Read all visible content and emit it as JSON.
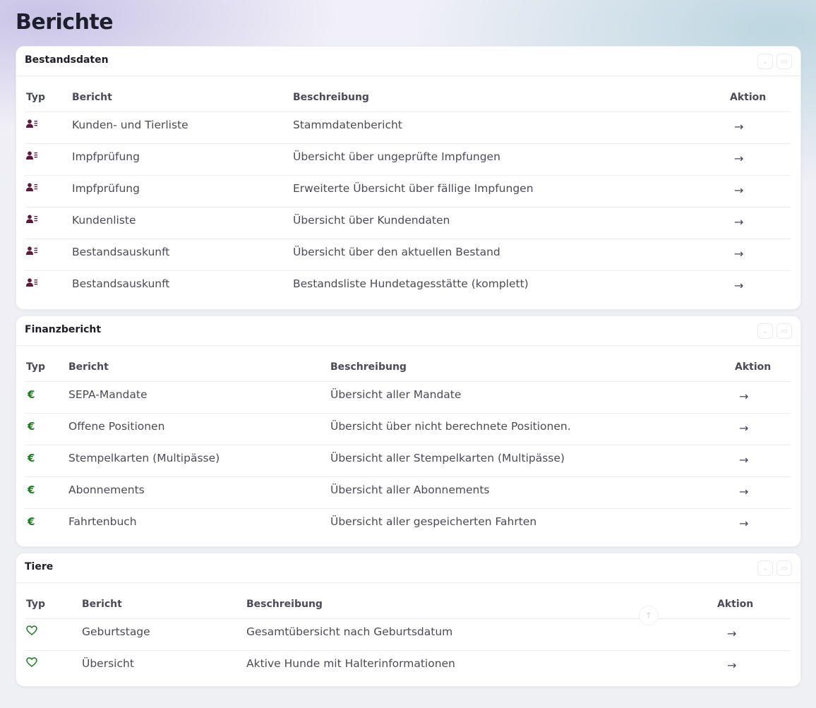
{
  "page": {
    "title": "Berichte"
  },
  "colors": {
    "person_icon": "#5a1a3a",
    "euro": "#1f7a1f",
    "heart": "#1f7a1f"
  },
  "sections": [
    {
      "title": "Bestandsdaten",
      "icon": "person-list-icon",
      "columns": {
        "typ": "Typ",
        "bericht": "Bericht",
        "beschreibung": "Beschreibung",
        "aktion": "Aktion"
      },
      "rows": [
        {
          "bericht": "Kunden- und Tierliste",
          "beschreibung": "Stammdatenbericht",
          "aktion": "→"
        },
        {
          "bericht": "Impfprüfung",
          "beschreibung": "Übersicht über ungeprüfte Impfungen",
          "aktion": "→"
        },
        {
          "bericht": "Impfprüfung",
          "beschreibung": "Erweiterte Übersicht über fällige Impfungen",
          "aktion": "→"
        },
        {
          "bericht": "Kundenliste",
          "beschreibung": "Übersicht über Kundendaten",
          "aktion": "→"
        },
        {
          "bericht": "Bestandsauskunft",
          "beschreibung": "Übersicht über den aktuellen Bestand",
          "aktion": "→"
        },
        {
          "bericht": "Bestandsauskunft",
          "beschreibung": "Bestandsliste Hundetagesstätte (komplett)",
          "aktion": "→"
        }
      ]
    },
    {
      "title": "Finanzbericht",
      "icon": "euro-icon",
      "symbol": "€",
      "columns": {
        "typ": "Typ",
        "bericht": "Bericht",
        "beschreibung": "Beschreibung",
        "aktion": "Aktion"
      },
      "rows": [
        {
          "bericht": "SEPA-Mandate",
          "beschreibung": "Übersicht aller Mandate",
          "aktion": "→"
        },
        {
          "bericht": "Offene Positionen",
          "beschreibung": "Übersicht über nicht berechnete Positionen.",
          "aktion": "→"
        },
        {
          "bericht": "Stempelkarten (Multipässe)",
          "beschreibung": "Übersicht aller Stempelkarten (Multipässe)",
          "aktion": "→"
        },
        {
          "bericht": "Abonnements",
          "beschreibung": "Übersicht aller Abonnements",
          "aktion": "→"
        },
        {
          "bericht": "Fahrtenbuch",
          "beschreibung": "Übersicht aller gespeicherten Fahrten",
          "aktion": "→"
        }
      ]
    },
    {
      "title": "Tiere",
      "icon": "heart-icon",
      "columns": {
        "typ": "Typ",
        "bericht": "Bericht",
        "beschreibung": "Beschreibung",
        "aktion": "Aktion"
      },
      "rows": [
        {
          "bericht": "Geburtstage",
          "beschreibung": "Gesamtübersicht nach Geburtsdatum",
          "aktion": "→"
        },
        {
          "bericht": "Übersicht",
          "beschreibung": "Aktive Hunde mit Halterinformationen",
          "aktion": "→"
        }
      ]
    }
  ]
}
